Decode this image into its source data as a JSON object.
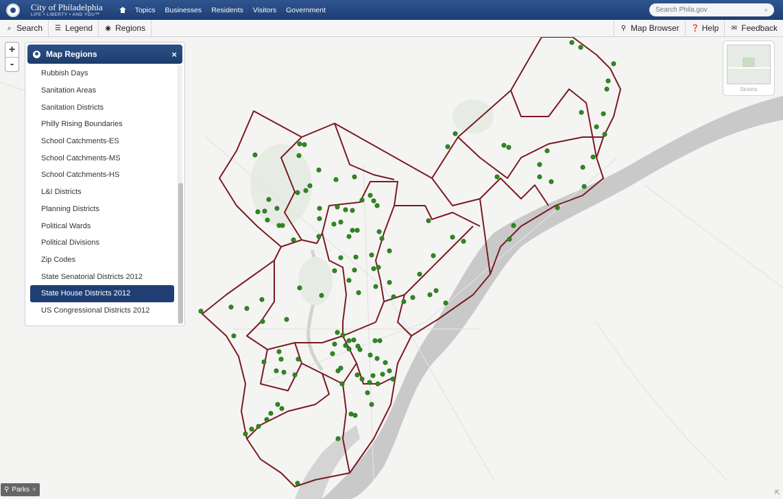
{
  "header": {
    "brand_title": "City of Philadelphia",
    "brand_tagline": "LIFE • LIBERTY • AND YOU™",
    "nav": [
      "Topics",
      "Businesses",
      "Residents",
      "Visitors",
      "Government"
    ],
    "search_placeholder": "Search Phila.gov"
  },
  "toolbar": {
    "left": [
      {
        "label": "Search",
        "icon": "search-icon"
      },
      {
        "label": "Legend",
        "icon": "list-icon"
      },
      {
        "label": "Regions",
        "icon": "globe-icon"
      }
    ],
    "right": [
      {
        "label": "Map Browser",
        "icon": "map-marker-icon"
      },
      {
        "label": "Help",
        "icon": "question-icon"
      },
      {
        "label": "Feedback",
        "icon": "comment-icon"
      }
    ]
  },
  "zoom": {
    "in": "+",
    "out": "-"
  },
  "regions_panel": {
    "title": "Map Regions",
    "close": "×",
    "items": [
      "Rubbish Days",
      "Sanitation Areas",
      "Sanitation Districts",
      "Philly Rising Boundaries",
      "School Catchments-ES",
      "School Catchments-MS",
      "School Catchments-HS",
      "L&I Districts",
      "Planning Districts",
      "Political Wards",
      "Political Divisions",
      "Zip Codes",
      "State Senatorial Districts 2012",
      "State House Districts 2012",
      "US Congressional Districts 2012"
    ],
    "selected": "State House Districts 2012"
  },
  "basemap": {
    "label": "Streets"
  },
  "layer_tag": {
    "label": "Parks",
    "remove": "×"
  },
  "colors": {
    "header_bg": "#1d3e72",
    "boundary": "#7a1a1f",
    "park_marker": "#2e8b1e",
    "water": "#c8c8c8",
    "selected_item": "#1f3f74"
  }
}
